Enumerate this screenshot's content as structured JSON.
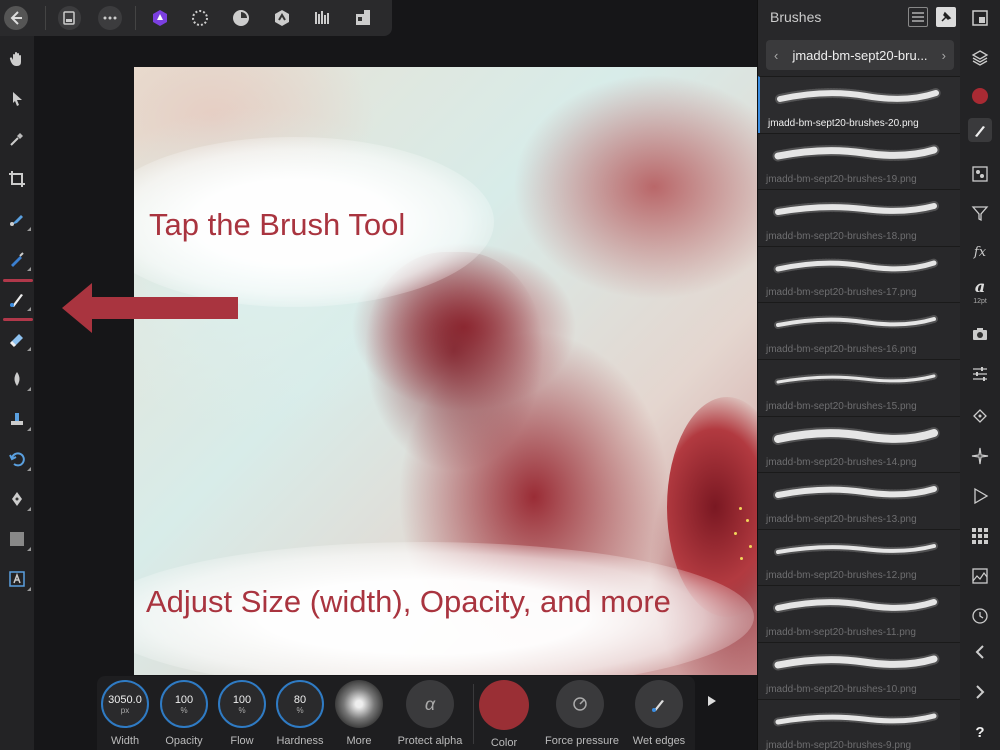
{
  "colors": {
    "accent_blue": "#2f7bc4",
    "annotation_red": "#a9343f",
    "brush_color": "#9a2f35",
    "selection_red": "#b0384a"
  },
  "top_toolbar": {
    "buttons": [
      "back-icon",
      "document-icon",
      "more-icon",
      "photo-persona-icon",
      "liquify-persona-icon",
      "develop-persona-icon",
      "tone-mapping-persona-icon",
      "export-persona-icon",
      "assistant-icon"
    ]
  },
  "annotations": {
    "tap_brush": "Tap the Brush Tool",
    "adjust": "Adjust Size (width), Opacity, and more"
  },
  "brushes_panel": {
    "title": "Brushes",
    "category": "jmadd-bm-sept20-bru...",
    "items": [
      "jmadd-bm-sept20-brushes-20.png",
      "jmadd-bm-sept20-brushes-19.png",
      "jmadd-bm-sept20-brushes-18.png",
      "jmadd-bm-sept20-brushes-17.png",
      "jmadd-bm-sept20-brushes-16.png",
      "jmadd-bm-sept20-brushes-15.png",
      "jmadd-bm-sept20-brushes-14.png",
      "jmadd-bm-sept20-brushes-13.png",
      "jmadd-bm-sept20-brushes-12.png",
      "jmadd-bm-sept20-brushes-11.png",
      "jmadd-bm-sept20-brushes-10.png",
      "jmadd-bm-sept20-brushes-9.png"
    ]
  },
  "studio": {
    "font_size_label": "12pt"
  },
  "context_toolbar": {
    "width": {
      "value": "3050.0",
      "unit": "px",
      "label": "Width"
    },
    "opacity": {
      "value": "100",
      "unit": "%",
      "label": "Opacity"
    },
    "flow": {
      "value": "100",
      "unit": "%",
      "label": "Flow"
    },
    "hardness": {
      "value": "80",
      "unit": "%",
      "label": "Hardness"
    },
    "more": {
      "label": "More"
    },
    "protect_alpha": {
      "label": "Protect alpha",
      "glyph": "α"
    },
    "color": {
      "label": "Color"
    },
    "force_pressure": {
      "label": "Force pressure"
    },
    "wet_edges": {
      "label": "Wet edges"
    }
  }
}
